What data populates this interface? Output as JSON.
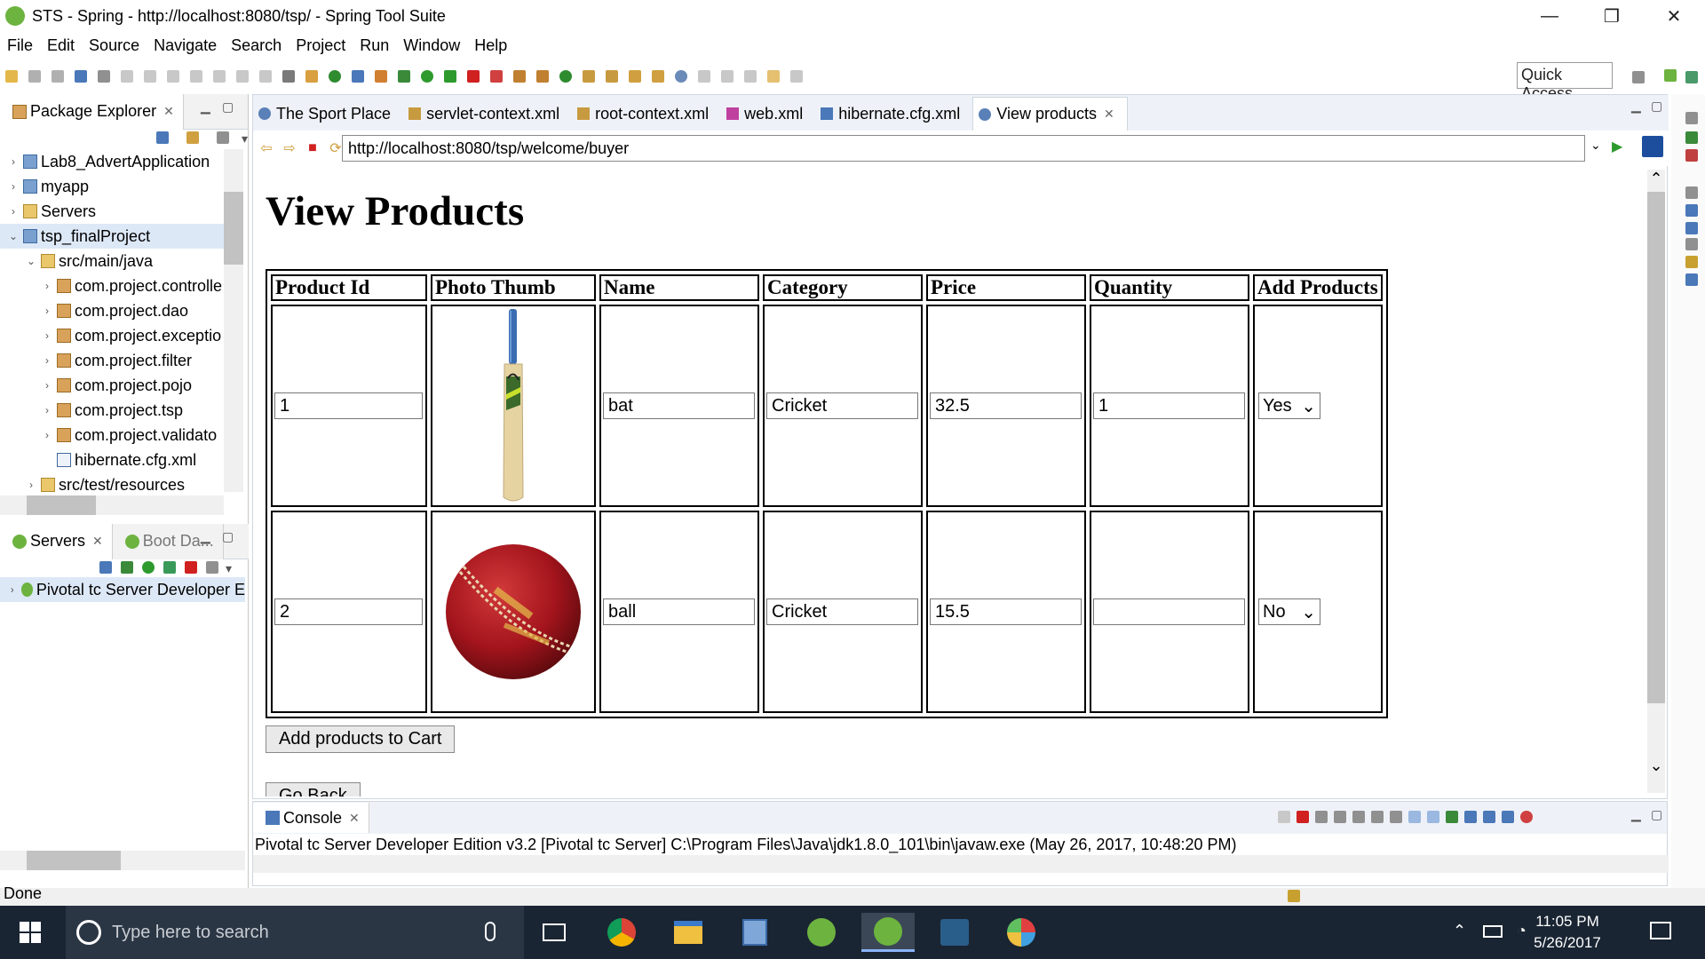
{
  "window": {
    "title": "STS - Spring - http://localhost:8080/tsp/ - Spring Tool Suite",
    "minimize": "—",
    "restore": "❐",
    "close": "✕"
  },
  "menu": [
    "File",
    "Edit",
    "Source",
    "Navigate",
    "Search",
    "Project",
    "Run",
    "Window",
    "Help"
  ],
  "quick_access": "Quick Access",
  "package_explorer": {
    "tab_label": "Package Explorer",
    "close": "✕",
    "items": [
      {
        "label": "Lab8_AdvertApplication",
        "twisty": "›"
      },
      {
        "label": "myapp",
        "twisty": "›"
      },
      {
        "label": "Servers",
        "twisty": "›"
      },
      {
        "label": "tsp_finalProject",
        "twisty": "⌄"
      },
      {
        "label": "src/main/java",
        "twisty": "⌄"
      },
      {
        "label": "com.project.controlle",
        "twisty": "›"
      },
      {
        "label": "com.project.dao",
        "twisty": "›"
      },
      {
        "label": "com.project.exceptio",
        "twisty": "›"
      },
      {
        "label": "com.project.filter",
        "twisty": "›"
      },
      {
        "label": "com.project.pojo",
        "twisty": "›"
      },
      {
        "label": "com.project.tsp",
        "twisty": "›"
      },
      {
        "label": "com.project.validato",
        "twisty": "›"
      },
      {
        "label": "hibernate.cfg.xml",
        "twisty": ""
      },
      {
        "label": "src/test/resources",
        "twisty": "›"
      }
    ]
  },
  "servers_view": {
    "tab_label": "Servers",
    "close": "✕",
    "other_tab": "Boot Da...",
    "items": [
      {
        "label": "Pivotal tc Server Developer E",
        "twisty": "›"
      }
    ]
  },
  "editor": {
    "tabs": [
      {
        "label": "The Sport Place",
        "active": false
      },
      {
        "label": "servlet-context.xml",
        "active": false
      },
      {
        "label": "root-context.xml",
        "active": false
      },
      {
        "label": "web.xml",
        "active": false
      },
      {
        "label": "hibernate.cfg.xml",
        "active": false
      },
      {
        "label": "View products",
        "active": true
      }
    ],
    "tab_close": "✕",
    "url": "http://localhost:8080/tsp/welcome/buyer"
  },
  "page": {
    "heading": "View Products",
    "columns": [
      "Product Id",
      "Photo Thumb",
      "Name",
      "Category",
      "Price",
      "Quantity",
      "Add Products"
    ],
    "rows": [
      {
        "id": "1",
        "photo": "cricket-bat",
        "name": "bat",
        "category": "Cricket",
        "price": "32.5",
        "quantity": "1",
        "add": "Yes"
      },
      {
        "id": "2",
        "photo": "cricket-ball",
        "name": "ball",
        "category": "Cricket",
        "price": "15.5",
        "quantity": "",
        "add": "No"
      }
    ],
    "add_button": "Add products to Cart",
    "back_button": "Go Back"
  },
  "console": {
    "tab_label": "Console",
    "close": "✕",
    "text": "Pivotal tc Server Developer Edition v3.2 [Pivotal tc Server] C:\\Program Files\\Java\\jdk1.8.0_101\\bin\\javaw.exe (May 26, 2017, 10:48:20 PM)"
  },
  "status": "Done",
  "taskbar": {
    "search_placeholder": "Type here to search",
    "time": "11:05 PM",
    "date": "5/26/2017"
  },
  "colors": {
    "selection": "#dde8f7",
    "taskbar_bg": "#1a2533",
    "spring_green": "#6db33f",
    "ball_red": "#a3141c"
  }
}
